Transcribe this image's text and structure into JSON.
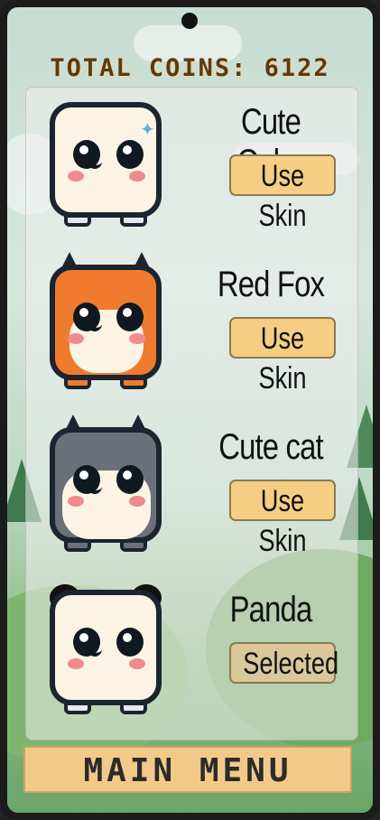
{
  "hud": {
    "total_coins_label": "TOTAL COINS:",
    "total_coins_value": "6122"
  },
  "skins": [
    {
      "name": "Cute Cube",
      "button": "Use Skin",
      "selected": false,
      "icon": "cube-character-icon",
      "color": "#fbf4e4"
    },
    {
      "name": "Red Fox",
      "button": "Use Skin",
      "selected": false,
      "icon": "fox-character-icon",
      "color": "#f07b2f"
    },
    {
      "name": "Cute cat",
      "button": "Use Skin",
      "selected": false,
      "icon": "cat-character-icon",
      "color": "#6c7079"
    },
    {
      "name": "Panda",
      "button": "Selected",
      "selected": true,
      "icon": "panda-character-icon",
      "color": "#fbf4e4"
    }
  ],
  "footer": {
    "main_menu_label": "MAIN MENU"
  },
  "colors": {
    "button": "#f6ce83",
    "menu": "#f3c98a",
    "coins_text": "#5b3a12"
  }
}
